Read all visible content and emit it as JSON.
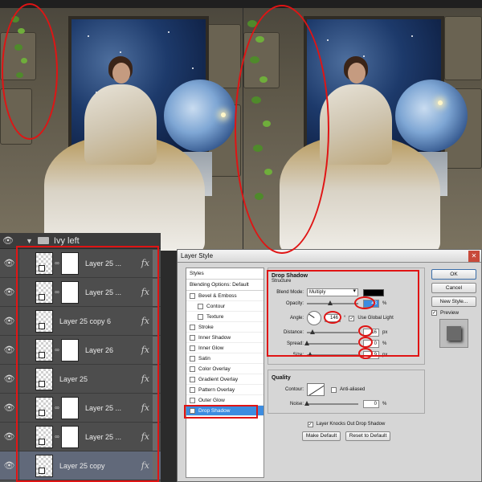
{
  "layers_panel": {
    "group_name": "Ivy left",
    "layers": [
      {
        "name": "Layer 25 ...",
        "fx": "fx",
        "has_mask": true,
        "selected": false
      },
      {
        "name": "Layer 25 ...",
        "fx": "fx",
        "has_mask": true,
        "selected": false
      },
      {
        "name": "Layer 25 copy 6",
        "fx": "fx",
        "has_mask": false,
        "selected": false
      },
      {
        "name": "Layer 26",
        "fx": "fx",
        "has_mask": true,
        "selected": false
      },
      {
        "name": "Layer 25",
        "fx": "fx",
        "has_mask": false,
        "selected": false
      },
      {
        "name": "Layer 25 ...",
        "fx": "fx",
        "has_mask": true,
        "selected": false
      },
      {
        "name": "Layer 25 ...",
        "fx": "fx",
        "has_mask": true,
        "selected": false
      },
      {
        "name": "Layer 25 copy",
        "fx": "fx",
        "has_mask": false,
        "selected": true
      }
    ]
  },
  "dialog": {
    "title": "Layer Style",
    "styles_header": "Styles",
    "blending_options": "Blending Options: Default",
    "style_items": [
      {
        "label": "Bevel & Emboss",
        "checked": false,
        "sub": false,
        "active": false
      },
      {
        "label": "Contour",
        "checked": false,
        "sub": true,
        "active": false
      },
      {
        "label": "Texture",
        "checked": false,
        "sub": true,
        "active": false
      },
      {
        "label": "Stroke",
        "checked": false,
        "sub": false,
        "active": false
      },
      {
        "label": "Inner Shadow",
        "checked": false,
        "sub": false,
        "active": false
      },
      {
        "label": "Inner Glow",
        "checked": false,
        "sub": false,
        "active": false
      },
      {
        "label": "Satin",
        "checked": false,
        "sub": false,
        "active": false
      },
      {
        "label": "Color Overlay",
        "checked": false,
        "sub": false,
        "active": false
      },
      {
        "label": "Gradient Overlay",
        "checked": false,
        "sub": false,
        "active": false
      },
      {
        "label": "Pattern Overlay",
        "checked": false,
        "sub": false,
        "active": false
      },
      {
        "label": "Outer Glow",
        "checked": false,
        "sub": false,
        "active": false
      },
      {
        "label": "Drop Shadow",
        "checked": true,
        "sub": false,
        "active": true
      }
    ],
    "drop_shadow": {
      "title": "Drop Shadow",
      "subtitle": "Structure",
      "blend_mode_label": "Blend Mode:",
      "blend_mode": "Multiply",
      "shadow_color": "#000000",
      "opacity_label": "Opacity:",
      "opacity": "43",
      "angle_label": "Angle:",
      "angle": "146",
      "use_global_light": "Use Global Light",
      "distance_label": "Distance:",
      "distance": "16",
      "spread_label": "Spread:",
      "spread": "0",
      "size_label": "Size:",
      "size": "9",
      "pct": "%",
      "px": "px"
    },
    "quality": {
      "title": "Quality",
      "contour_label": "Contour:",
      "anti_aliased": "Anti-aliased",
      "noise_label": "Noise:",
      "noise": "0",
      "pct": "%"
    },
    "knockout_label": "Layer Knocks Out Drop Shadow",
    "make_default": "Make Default",
    "reset_default": "Reset to Default",
    "ok": "OK",
    "cancel": "Cancel",
    "new_style": "New Style...",
    "preview": "Preview",
    "close_glyph": "✕"
  },
  "colors": {
    "highlight_red": "#e01414",
    "selection_blue": "#3c8ce0"
  }
}
